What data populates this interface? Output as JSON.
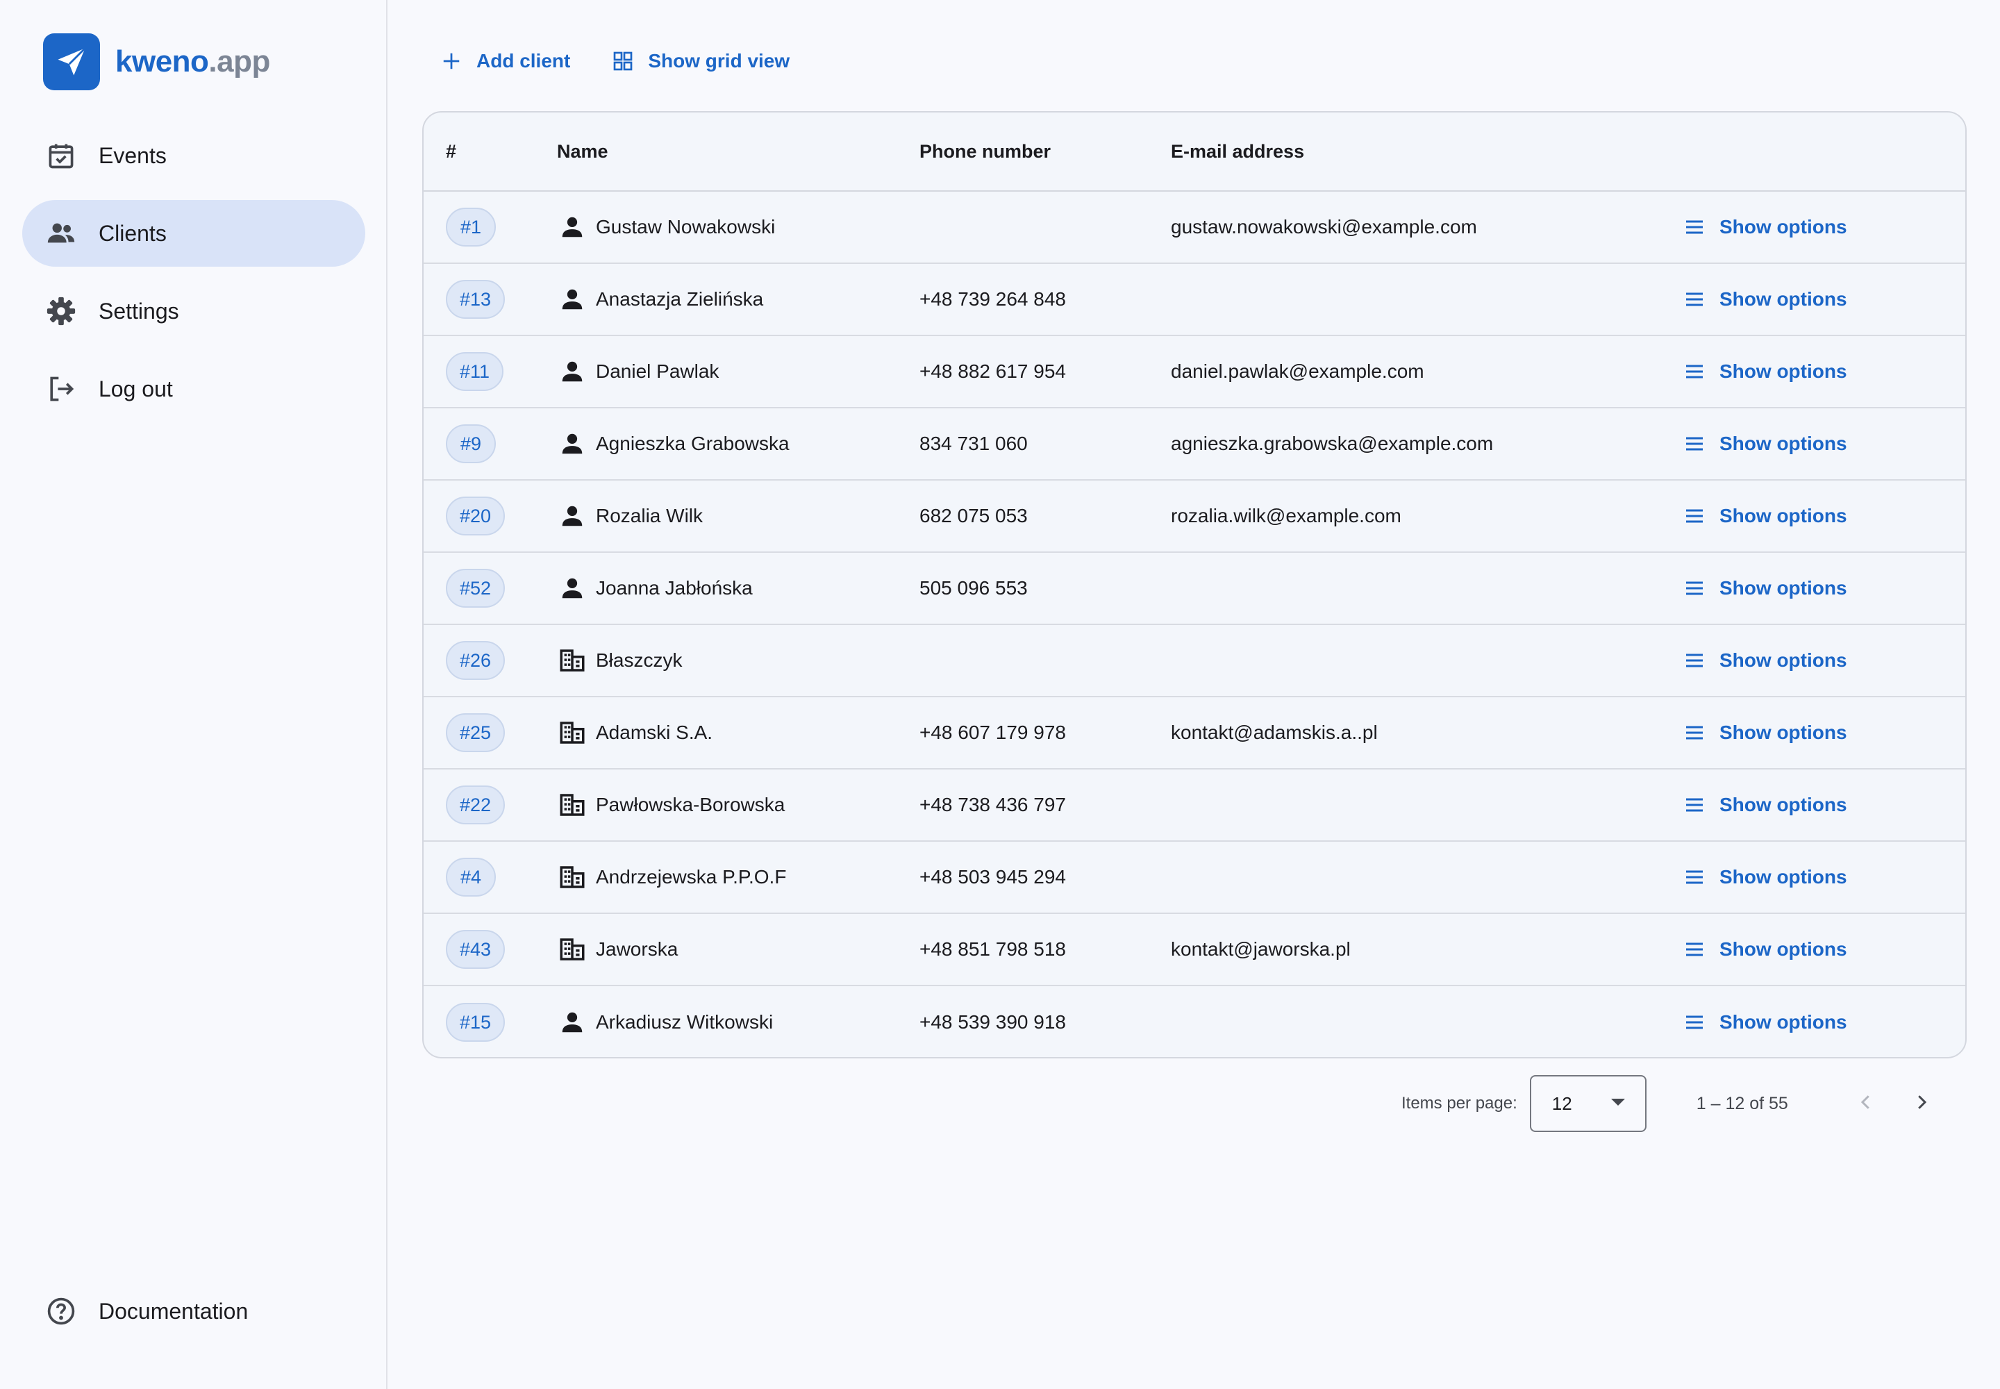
{
  "brand": {
    "name_primary": "kweno",
    "name_secondary": ".app",
    "accent": "#1c66c7"
  },
  "sidebar": {
    "items": [
      {
        "label": "Events",
        "icon": "calendar-check-icon",
        "active": false
      },
      {
        "label": "Clients",
        "icon": "people-icon",
        "active": true
      },
      {
        "label": "Settings",
        "icon": "gear-icon",
        "active": false
      },
      {
        "label": "Log out",
        "icon": "logout-icon",
        "active": false
      }
    ],
    "bottom": {
      "label": "Documentation",
      "icon": "help-circle-icon"
    }
  },
  "toolbar": {
    "add_label": "Add client",
    "grid_label": "Show grid view"
  },
  "table": {
    "headers": {
      "id": "#",
      "name": "Name",
      "phone": "Phone number",
      "email": "E-mail address"
    },
    "options_label": "Show options",
    "rows": [
      {
        "id": "#1",
        "type": "person",
        "name": "Gustaw Nowakowski",
        "phone": "",
        "email": "gustaw.nowakowski@example.com"
      },
      {
        "id": "#13",
        "type": "person",
        "name": "Anastazja Zielińska",
        "phone": "+48 739 264 848",
        "email": ""
      },
      {
        "id": "#11",
        "type": "person",
        "name": "Daniel Pawlak",
        "phone": "+48 882 617 954",
        "email": "daniel.pawlak@example.com"
      },
      {
        "id": "#9",
        "type": "person",
        "name": "Agnieszka Grabowska",
        "phone": "834 731 060",
        "email": "agnieszka.grabowska@example.com"
      },
      {
        "id": "#20",
        "type": "person",
        "name": "Rozalia Wilk",
        "phone": "682 075 053",
        "email": "rozalia.wilk@example.com"
      },
      {
        "id": "#52",
        "type": "person",
        "name": "Joanna Jabłońska",
        "phone": "505 096 553",
        "email": ""
      },
      {
        "id": "#26",
        "type": "company",
        "name": "Błaszczyk",
        "phone": "",
        "email": ""
      },
      {
        "id": "#25",
        "type": "company",
        "name": "Adamski S.A.",
        "phone": "+48 607 179 978",
        "email": "kontakt@adamskis.a..pl"
      },
      {
        "id": "#22",
        "type": "company",
        "name": "Pawłowska-Borowska",
        "phone": "+48 738 436 797",
        "email": ""
      },
      {
        "id": "#4",
        "type": "company",
        "name": "Andrzejewska P.P.O.F",
        "phone": "+48 503 945 294",
        "email": ""
      },
      {
        "id": "#43",
        "type": "company",
        "name": "Jaworska",
        "phone": "+48 851 798 518",
        "email": "kontakt@jaworska.pl"
      },
      {
        "id": "#15",
        "type": "person",
        "name": "Arkadiusz Witkowski",
        "phone": "+48 539 390 918",
        "email": ""
      }
    ]
  },
  "paginator": {
    "items_per_page_label": "Items per page:",
    "items_per_page": "12",
    "range": "1 – 12 of 55"
  }
}
